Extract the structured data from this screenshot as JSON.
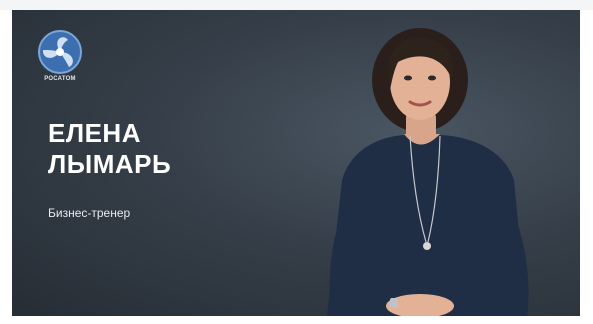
{
  "logo": {
    "text": "РОСАТОМ",
    "icon": "rosatom-logo-icon"
  },
  "speaker": {
    "first_name": "ЕЛЕНА",
    "last_name": "ЛЫМАРЬ",
    "role": "Бизнес-тренер"
  },
  "colors": {
    "background": "#363f49",
    "text": "#ffffff",
    "logo": "#7aa6d8"
  }
}
